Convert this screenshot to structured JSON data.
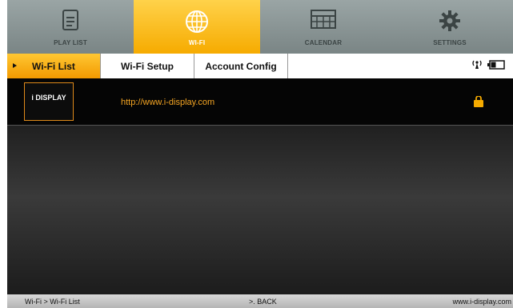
{
  "nav": {
    "items": [
      {
        "label": "PLAY LIST",
        "icon": "document-icon"
      },
      {
        "label": "WI-FI",
        "icon": "globe-icon"
      },
      {
        "label": "CALENDAR",
        "icon": "calendar-icon"
      },
      {
        "label": "SETTINGS",
        "icon": "gear-icon"
      }
    ],
    "active_index": 1
  },
  "tabs": {
    "items": [
      {
        "label": "Wi-Fi List"
      },
      {
        "label": "Wi-Fi Setup"
      },
      {
        "label": "Account Config"
      }
    ],
    "active_index": 0
  },
  "wifi_list": {
    "rows": [
      {
        "name": "i DISPLAY",
        "url": "http://www.i-display.com",
        "lock_icon": "lock-icon"
      }
    ]
  },
  "footer": {
    "breadcrumb": "Wi-Fi > Wi-Fi List",
    "back": ">. BACK",
    "site": "www.i-display.com"
  },
  "colors": {
    "accent": "#f6ab00",
    "url": "#f6a623",
    "nav_bg": "#8a9494"
  }
}
